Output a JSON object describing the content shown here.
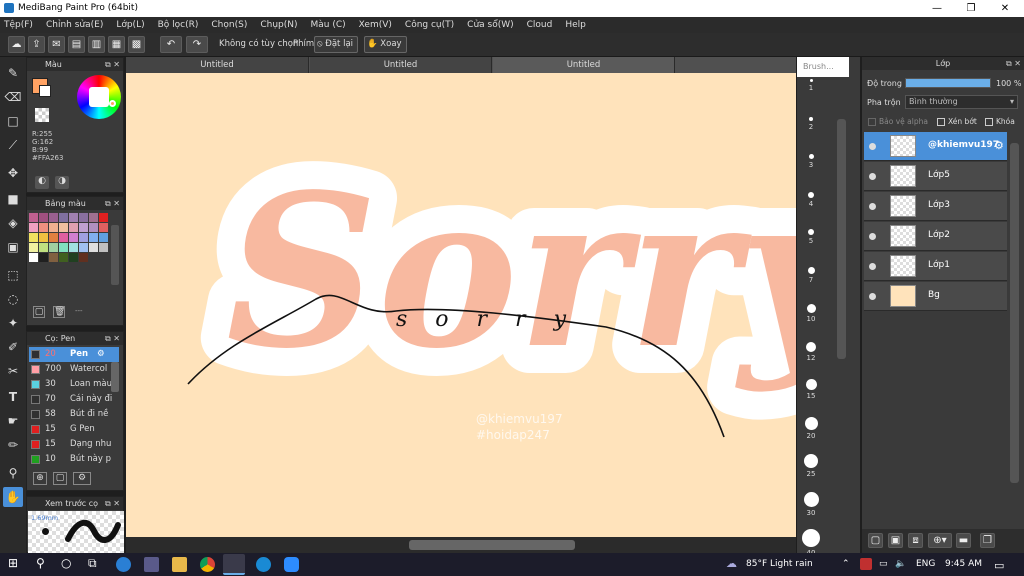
{
  "window": {
    "title": "MediBang Paint Pro (64bit)",
    "minimize": "—",
    "maximize": "❐",
    "close": "✕"
  },
  "menu": [
    "Tệp(F)",
    "Chỉnh sửa(E)",
    "Lớp(L)",
    "Bộ lọc(R)",
    "Chọn(S)",
    "Chụp(N)",
    "Màu (C)",
    "Xem(V)",
    "Công cụ(T)",
    "Cửa sổ(W)",
    "Cloud",
    "Help"
  ],
  "toolbar": {
    "no_selection": "Không có tùy chọn",
    "shortcut": "Phím",
    "reset": "Đặt lại",
    "rotate": "Xoay"
  },
  "tabs": [
    "Untitled",
    "Untitled",
    "Untitled"
  ],
  "color_panel": {
    "title": "Màu",
    "r": "R:255",
    "g": "G:162",
    "b": "B:99",
    "hex": "#FFA263",
    "main_color": "#ffa263"
  },
  "palette": {
    "title": "Bảng màu",
    "swatches": [
      "#c06090",
      "#a05080",
      "#9a6090",
      "#8070a0",
      "#a080b0",
      "#8a70a0",
      "#a07090",
      "#e02020",
      "#f0a0c0",
      "#f09080",
      "#f0b090",
      "#f0c0a0",
      "#e0a0b0",
      "#c0a0d0",
      "#b090c0",
      "#e06060",
      "#f0e060",
      "#f0c040",
      "#e08040",
      "#e060a0",
      "#d080d0",
      "#a0a0e0",
      "#80b0f0",
      "#60a0e0",
      "#f0f0a0",
      "#c0e080",
      "#a0d0a0",
      "#80e0c0",
      "#a0e0e0",
      "#a0c0f0",
      "#e0e0e0",
      "#c0c0c0",
      "#ffffff",
      "#202020",
      "#806040",
      "#406020",
      "#204020",
      "#603020",
      "#3a3a3a",
      "#3a3a3a"
    ],
    "footer_text": "---"
  },
  "brush_panel": {
    "title": "Cọ: Pen",
    "items": [
      {
        "size": "20",
        "name": "Pen",
        "color": "#303030"
      },
      {
        "size": "700",
        "name": "Watercol",
        "color": "#ff9ea5"
      },
      {
        "size": "30",
        "name": "Loan màu",
        "color": "#5ad0e0"
      },
      {
        "size": "70",
        "name": "Cái này đi",
        "color": "#303030"
      },
      {
        "size": "58",
        "name": "Bút đi nề",
        "color": "#303030"
      },
      {
        "size": "15",
        "name": "G Pen",
        "color": "#e02020"
      },
      {
        "size": "15",
        "name": "Dạng nhu",
        "color": "#e02020"
      },
      {
        "size": "10",
        "name": "Bút này p",
        "color": "#20a020"
      }
    ]
  },
  "preview": {
    "title": "Xem trước cọ",
    "size": "1.69mm"
  },
  "brush_size_panel": {
    "title": "Brush...",
    "sizes": [
      "1",
      "2",
      "3",
      "4",
      "5",
      "7",
      "10",
      "12",
      "15",
      "20",
      "25",
      "30",
      "40"
    ]
  },
  "layers_panel": {
    "title": "Lớp",
    "opacity_label": "Độ trong",
    "opacity_value": "100 %",
    "opacity": 1.0,
    "blend_label": "Pha trộn",
    "blend_value": "Bình thường",
    "protect_alpha": "Bảo vệ alpha",
    "clipping": "Xén bớt",
    "lock": "Khóa",
    "layers": [
      {
        "name": "@khiemvu197",
        "selected": true
      },
      {
        "name": "Lớp5",
        "selected": false
      },
      {
        "name": "Lớp3",
        "selected": false
      },
      {
        "name": "Lớp2",
        "selected": false
      },
      {
        "name": "Lớp1",
        "selected": false
      },
      {
        "name": "Bg",
        "selected": false
      }
    ]
  },
  "canvas": {
    "background": "#ffe3bb",
    "big_text": "Sorry",
    "script_text": "sorry",
    "watermark1": "@khiemvu197",
    "watermark2": "#hoidap247"
  },
  "taskbar": {
    "weather": "85°F  Light rain",
    "language": "ENG",
    "time": "9:45 AM"
  }
}
